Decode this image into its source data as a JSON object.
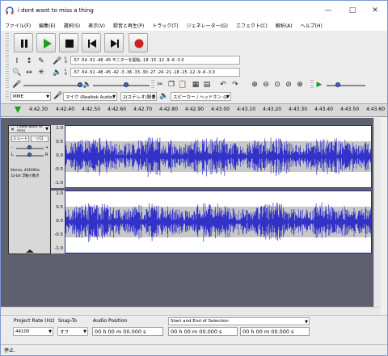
{
  "window": {
    "title": "i dont want to miss a thing",
    "app_icon": "headphones-icon"
  },
  "menu": [
    "ファイル(F)",
    "編集(E)",
    "選択(S)",
    "表示(V)",
    "録音と再生(P)",
    "トラック(T)",
    "ジェネレーター(G)",
    "エフェクト(C)",
    "解析(A)",
    "ヘルプ(H)"
  ],
  "transport": [
    "pause",
    "play",
    "stop",
    "skip-to-start",
    "skip-to-end",
    "record"
  ],
  "meters": {
    "record_scale": "-57 -54 -51 -48 -45   モニターを開始   -18 -15 -12  -9  -6  -3  0",
    "play_scale": "-57 -54 -51 -48 -45 -42 -3 -36 -33 -30 -27 -24 -21 -18 -15 -12  -9  -6  -3  0",
    "record_lr": [
      "L",
      "R"
    ],
    "play_lr": [
      "L",
      "R"
    ]
  },
  "device": {
    "host": "MME",
    "input": "マイク (Realtek Audio)",
    "channels": "2(ステレオ)録音チャ",
    "output": "スピーカー / ヘッドホン (R"
  },
  "ruler_ticks": [
    "4:42.30",
    "4:42.40",
    "4:42.50",
    "4:42.60",
    "4:42.70",
    "4:42.80",
    "4:42.90",
    "4:43.00",
    "4:43.10",
    "4:43.20",
    "4:43.30",
    "4:43.40",
    "4:43.50",
    "4:43.60"
  ],
  "track": {
    "name": "i dont want to miss",
    "mute": "ミュート",
    "solo": "ソロ",
    "pan_l": "L",
    "pan_r": "R",
    "info1": "Stereo, 44100Hz",
    "info2": "32-bit 浮動小数点",
    "scale": [
      "1.0",
      "0.5",
      "0.0",
      "-0.5",
      "-1.0"
    ]
  },
  "selection_bar": {
    "project_rate_label": "Project Rate (Hz)",
    "project_rate_value": "44100",
    "snap_label": "Snap-To",
    "snap_value": "オフ",
    "audio_position_label": "Audio Position",
    "audio_position_value": "00 h 00 m 00.000 s",
    "selection_label": "Start and End of Selection",
    "sel_start": "00 h 00 m 00.000 s",
    "sel_end": "00 h 00 m 00.000 s"
  },
  "status": "停止.",
  "colors": {
    "wave": "#3232c8",
    "wave_bg": "#ffffff",
    "track_bg": "#5e6070",
    "play_green": "#18a018",
    "record_red": "#d02020"
  }
}
